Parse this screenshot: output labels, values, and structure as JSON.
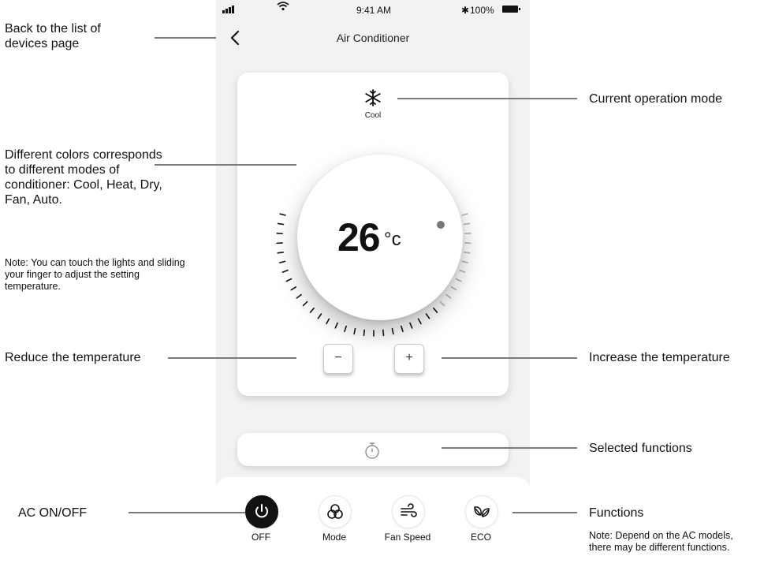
{
  "status_bar": {
    "time": "9:41 AM",
    "battery": "100%"
  },
  "header": {
    "title": "Air Conditioner"
  },
  "mode": {
    "icon": "snowflake-icon",
    "label": "Cool"
  },
  "temperature": {
    "value": "26",
    "unit": "°c"
  },
  "controls": {
    "minus_label": "−",
    "plus_label": "+"
  },
  "selected_functions": {
    "icon": "timer-icon"
  },
  "functions": [
    {
      "label": "OFF",
      "icon": "power-icon",
      "active": true
    },
    {
      "label": "Mode",
      "icon": "mode-icon",
      "active": false
    },
    {
      "label": "Fan Speed",
      "icon": "wind-icon",
      "active": false
    },
    {
      "label": "ECO",
      "icon": "leaf-icon",
      "active": false
    }
  ],
  "annotations": {
    "back": "Back to the list of devices page",
    "colors": "Different colors corresponds to different modes of conditioner: Cool, Heat, Dry, Fan, Auto.",
    "touch_note": "Note: You can touch the lights and sliding your finger to adjust the setting temperature.",
    "reduce": "Reduce the temperature",
    "onoff": "AC ON/OFF",
    "mode": "Current operation mode",
    "increase": "Increase the temperature",
    "selected": "Selected functions",
    "functions": "Functions",
    "functions_note": "Note: Depend on the AC models, there may be different functions."
  },
  "colors": {
    "active": "#111111",
    "connector": "#7a7a7a",
    "screen_bg": "#f2f2f2"
  }
}
